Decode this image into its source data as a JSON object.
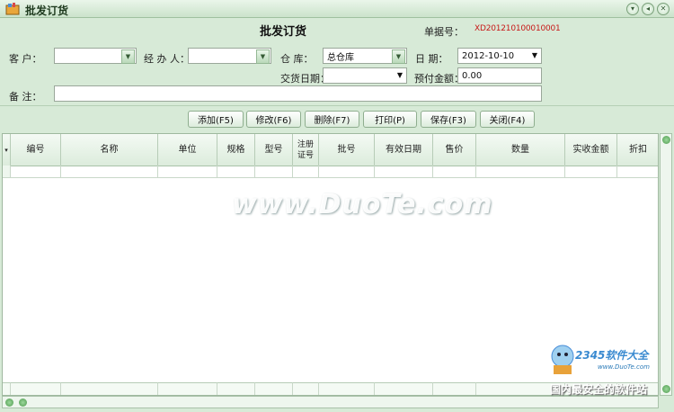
{
  "window": {
    "title": "批发订货",
    "min_symbol": "▾",
    "restore_symbol": "◂",
    "close_symbol": "✕"
  },
  "form": {
    "heading": "批发订货",
    "doc_no_label": "单据号：",
    "doc_no_value": "XD201210100010001",
    "customer_label": "客  户：",
    "customer_value": "",
    "handler_label": "经 办 人：",
    "handler_value": "",
    "warehouse_label": "仓  库：",
    "warehouse_value": "总仓库",
    "date_label": "日  期：",
    "date_value": "2012-10-10",
    "delivery_date_label": "交货日期：",
    "delivery_date_value": "",
    "prepay_label": "预付金额：",
    "prepay_value": "0.00",
    "remark_label": "备  注：",
    "remark_value": ""
  },
  "toolbar": {
    "add": "添加(F5)",
    "edit": "修改(F6)",
    "delete": "删除(F7)",
    "print": "打印(P)",
    "save": "保存(F3)",
    "close": "关闭(F4)"
  },
  "grid": {
    "row_indicator": "▾",
    "columns": [
      "编号",
      "名称",
      "单位",
      "规格",
      "型号",
      "注册\n证号",
      "批号",
      "有效日期",
      "售价",
      "数量",
      "实收金额",
      "折扣"
    ]
  },
  "overlay": {
    "watermark": "www.DuoTe.com",
    "logo_text": "2345软件大全",
    "logo_url": "www.DuoTe.com",
    "slogan": "国内最安全的软件站"
  },
  "colors": {
    "window_bg": "#d7ead7",
    "doc_no": "#c81818",
    "grid_header": "#dcecdc"
  }
}
